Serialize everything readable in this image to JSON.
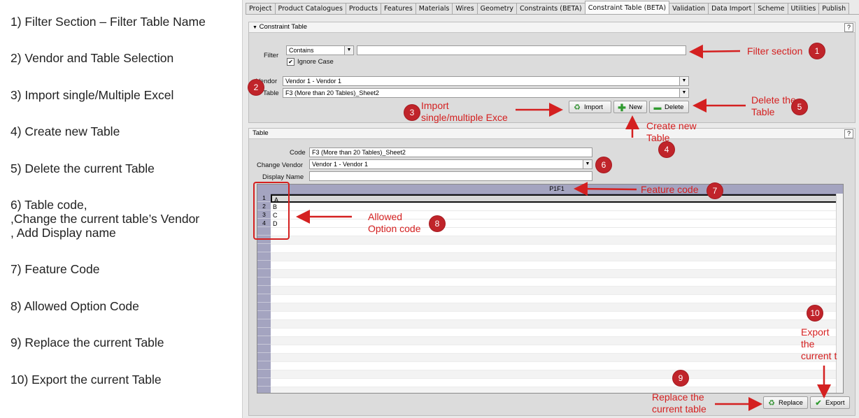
{
  "legend": [
    "1) Filter Section – Filter Table Name",
    "2) Vendor and Table Selection",
    "3) Import single/Multiple Excel",
    "4) Create new Table",
    "5) Delete the current Table",
    "6) Table code,",
    ",Change the current table’s Vendor",
    ", Add Display name",
    "7) Feature Code",
    "8) Allowed Option Code",
    "9) Replace the current Table",
    "10) Export the current Table"
  ],
  "tabs": [
    "Project",
    "Product Catalogues",
    "Products",
    "Features",
    "Materials",
    "Wires",
    "Geometry",
    "Constraints (BETA)",
    "Constraint Table (BETA)",
    "Validation",
    "Data Import",
    "Scheme",
    "Utilities",
    "Publish"
  ],
  "constraint_panel": {
    "title": "Constraint Table",
    "help": "?",
    "filter_label": "Filter",
    "filter_mode": "Contains",
    "filter_value": "",
    "ignore_case_label": "Ignore Case",
    "ignore_case_checked": "✔",
    "vendor_label": "Vendor",
    "vendor_value": "Vendor 1 - Vendor 1",
    "table_label": "Table",
    "table_value": "F3 (More than 20 Tables)_Sheet2",
    "import_label": "Import",
    "new_label": "New",
    "delete_label": "Delete"
  },
  "table_panel": {
    "title": "Table",
    "help": "?",
    "code_label": "Code",
    "code_value": "F3 (More than 20 Tables)_Sheet2",
    "change_vendor_label": "Change Vendor",
    "change_vendor_value": "Vendor 1 - Vendor 1",
    "display_name_label": "Display Name",
    "display_name_value": ""
  },
  "grid": {
    "column_header": "P1F1",
    "rows": [
      {
        "num": "1",
        "value": "A"
      },
      {
        "num": "2",
        "value": "B"
      },
      {
        "num": "3",
        "value": "C"
      },
      {
        "num": "4",
        "value": "D"
      }
    ]
  },
  "buttons": {
    "replace_label": "Replace",
    "export_label": "Export"
  },
  "annotations": {
    "filter_section": "Filter section",
    "import_line1": "Import",
    "import_line2": "single/multiple Exce",
    "delete_line1": "Delete the",
    "delete_line2": "Table",
    "create_line1": "Create new",
    "create_line2": "Table",
    "feature_code": "Feature code",
    "allowed_line1": "Allowed",
    "allowed_line2": "Option code",
    "export_line1": "Export",
    "export_line2": "the",
    "export_line3": "current t",
    "replace_line1": "Replace the",
    "replace_line2": "current table"
  },
  "badges": [
    "1",
    "2",
    "3",
    "4",
    "5",
    "6",
    "7",
    "8",
    "9",
    "10"
  ],
  "colors": {
    "annotation_red": "#d42020",
    "badge_red": "#c0242a",
    "grid_header": "#a4a4c0"
  }
}
